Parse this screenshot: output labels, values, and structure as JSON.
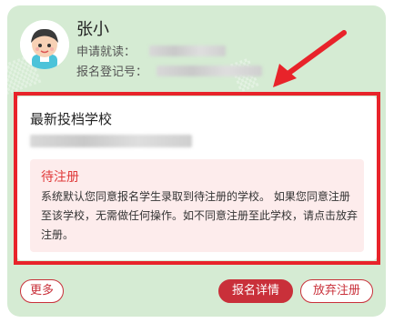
{
  "student": {
    "name": "张小",
    "apply_label": "申请就读：",
    "reg_label": "报名登记号："
  },
  "latest": {
    "title": "最新投档学校"
  },
  "notice": {
    "title": "待注册",
    "body": "系统默认您同意报名学生录取到待注册的学校。 如果您同意注册至该学校，无需做任何操作。如不同意注册至此学校，请点击放弃注册。"
  },
  "buttons": {
    "more": "更多",
    "detail": "报名详情",
    "abandon": "放弃注册"
  },
  "colors": {
    "card_bg": "#d5ebd3",
    "highlight": "#e8232a",
    "accent": "#c9303a",
    "notice_bg": "#fdecec"
  },
  "icons": {
    "avatar": "student-avatar-icon",
    "arrow": "annotation-arrow-icon"
  }
}
